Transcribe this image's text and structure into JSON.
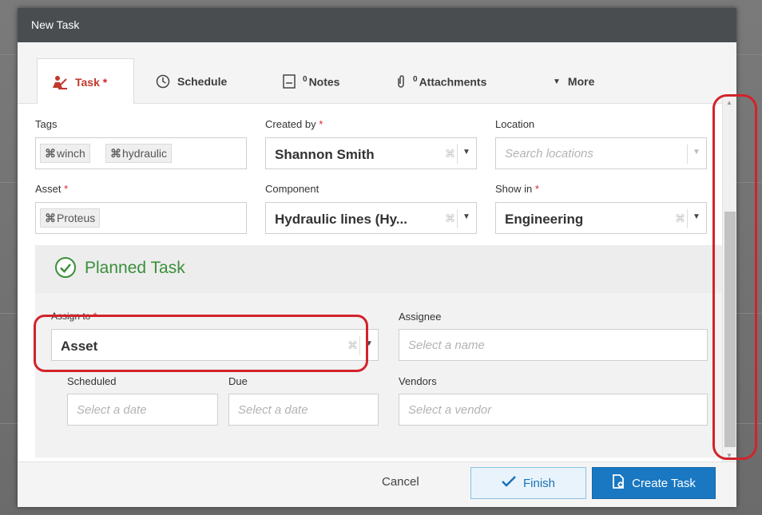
{
  "dialog": {
    "title": "New Task"
  },
  "tabs": [
    {
      "label": "Task",
      "required_mark": "*",
      "icon": "task-worker-icon"
    },
    {
      "label": "Schedule",
      "icon": "clock-icon"
    },
    {
      "count": "0",
      "label": "Notes",
      "icon": "note-icon"
    },
    {
      "count": "0",
      "label": "Attachments",
      "icon": "paperclip-icon"
    },
    {
      "label": "More",
      "icon": "caret-down-icon"
    }
  ],
  "form": {
    "tags": {
      "label": "Tags",
      "chips": [
        "winch",
        "hydraulic"
      ]
    },
    "created_by": {
      "label": "Created by",
      "required_mark": "*",
      "value": "Shannon Smith"
    },
    "location": {
      "label": "Location",
      "placeholder": "Search locations"
    },
    "asset": {
      "label": "Asset",
      "required_mark": "*",
      "chips": [
        "Proteus"
      ]
    },
    "component": {
      "label": "Component",
      "value": "Hydraulic lines (Hy..."
    },
    "show_in": {
      "label": "Show in",
      "required_mark": "*",
      "value": "Engineering"
    }
  },
  "planned_task": {
    "title": "Planned Task",
    "assign_to": {
      "label": "Assign to",
      "required_mark": "*",
      "value": "Asset"
    },
    "assignee": {
      "label": "Assignee",
      "placeholder": "Select a name"
    },
    "scheduled": {
      "label": "Scheduled",
      "placeholder": "Select a date"
    },
    "due": {
      "label": "Due",
      "placeholder": "Select a date"
    },
    "vendors": {
      "label": "Vendors",
      "placeholder": "Select a vendor"
    }
  },
  "footer": {
    "cancel_label": "Cancel",
    "finish_label": "Finish",
    "create_label": "Create Task"
  },
  "colors": {
    "accent_blue": "#1a78c2",
    "required_red": "#d9232e",
    "planned_green": "#3a8f3a",
    "highlight_red": "#d2232a",
    "titlebar": "#4a4d50"
  }
}
